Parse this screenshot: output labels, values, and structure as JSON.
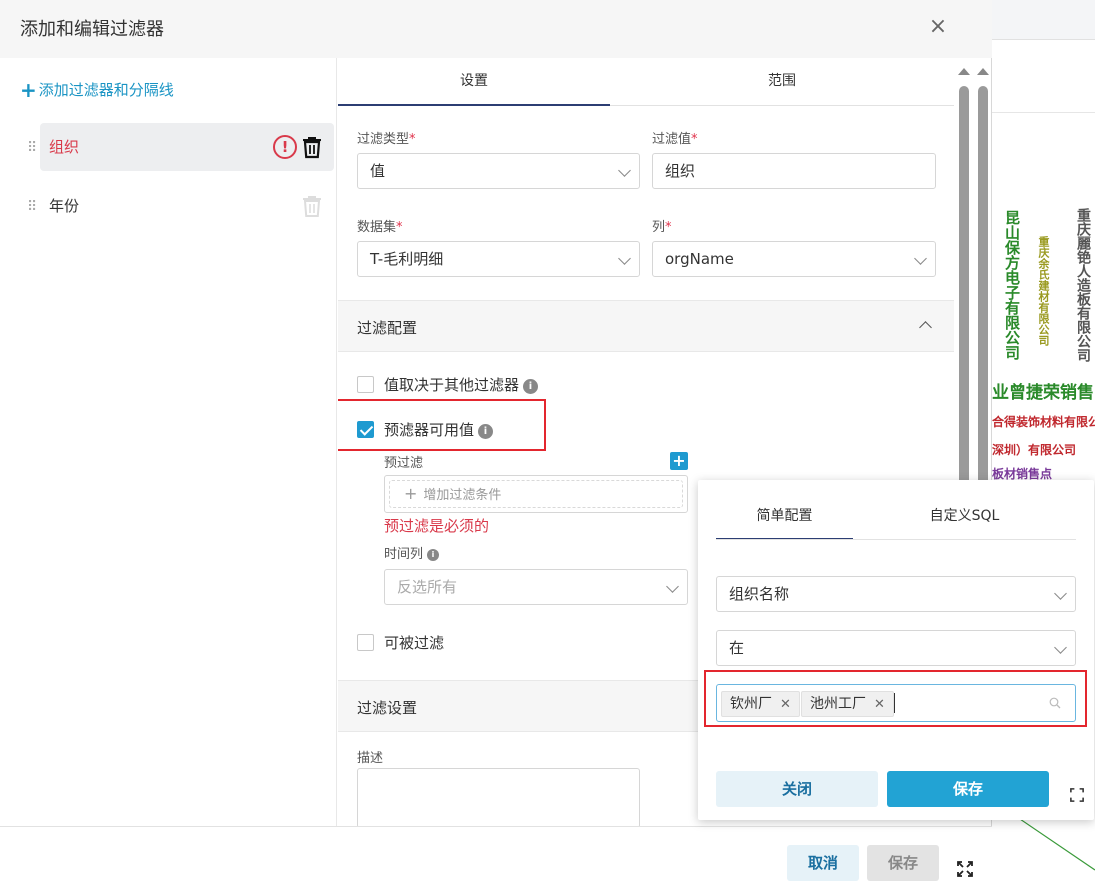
{
  "modal": {
    "title": "添加和编辑过滤器",
    "close_glyph": "×"
  },
  "left_panel": {
    "add_link": "添加过滤器和分隔线",
    "filters": [
      {
        "label": "组织",
        "selected": true,
        "warning": "!"
      },
      {
        "label": "年份",
        "selected": false
      }
    ]
  },
  "tabs": [
    {
      "label": "设置",
      "active": true
    },
    {
      "label": "范围",
      "active": false
    }
  ],
  "form": {
    "filter_type_label": "过滤类型",
    "filter_type_value": "值",
    "filter_value_label": "过滤值",
    "filter_value_value": "组织",
    "dataset_label": "数据集",
    "dataset_value": "T-毛利明细",
    "column_label": "列",
    "column_value": "orgName",
    "required_mark": "*"
  },
  "filter_config": {
    "title": "过滤配置",
    "depends_label": "值取决于其他过滤器",
    "prefilter_available_label": "预滤器可用值",
    "prefilter_label": "预过滤",
    "add_condition": "增加过滤条件",
    "error": "预过滤是必须的",
    "time_column_label": "时间列",
    "time_column_placeholder": "反选所有",
    "filterable_label": "可被过滤",
    "info_glyph": "i"
  },
  "filter_settings": {
    "title": "过滤设置",
    "description_label": "描述"
  },
  "footer": {
    "cancel": "取消",
    "save": "保存"
  },
  "popover": {
    "tabs": [
      {
        "label": "简单配置",
        "active": true
      },
      {
        "label": "自定义SQL",
        "active": false
      }
    ],
    "column_value": "组织名称",
    "operator_value": "在",
    "tags": [
      "钦州厂",
      "池州工厂"
    ],
    "close_button": "关闭",
    "save_button": "保存"
  },
  "background": {
    "vertical_texts": [
      "重庆麗铯人造板有限公司",
      "昆山保方电子有限公司",
      "重庆余氏建材有限公司"
    ],
    "horizontal_texts": [
      "业曾捷荣销售",
      "合得装饰材料有限公",
      "深圳）有限公司",
      "板材销售点"
    ]
  },
  "colors": {
    "accent": "#22a3d4",
    "error": "#d9394a",
    "highlight_box": "#e3262e",
    "tab_indicator": "#2c3e73"
  }
}
